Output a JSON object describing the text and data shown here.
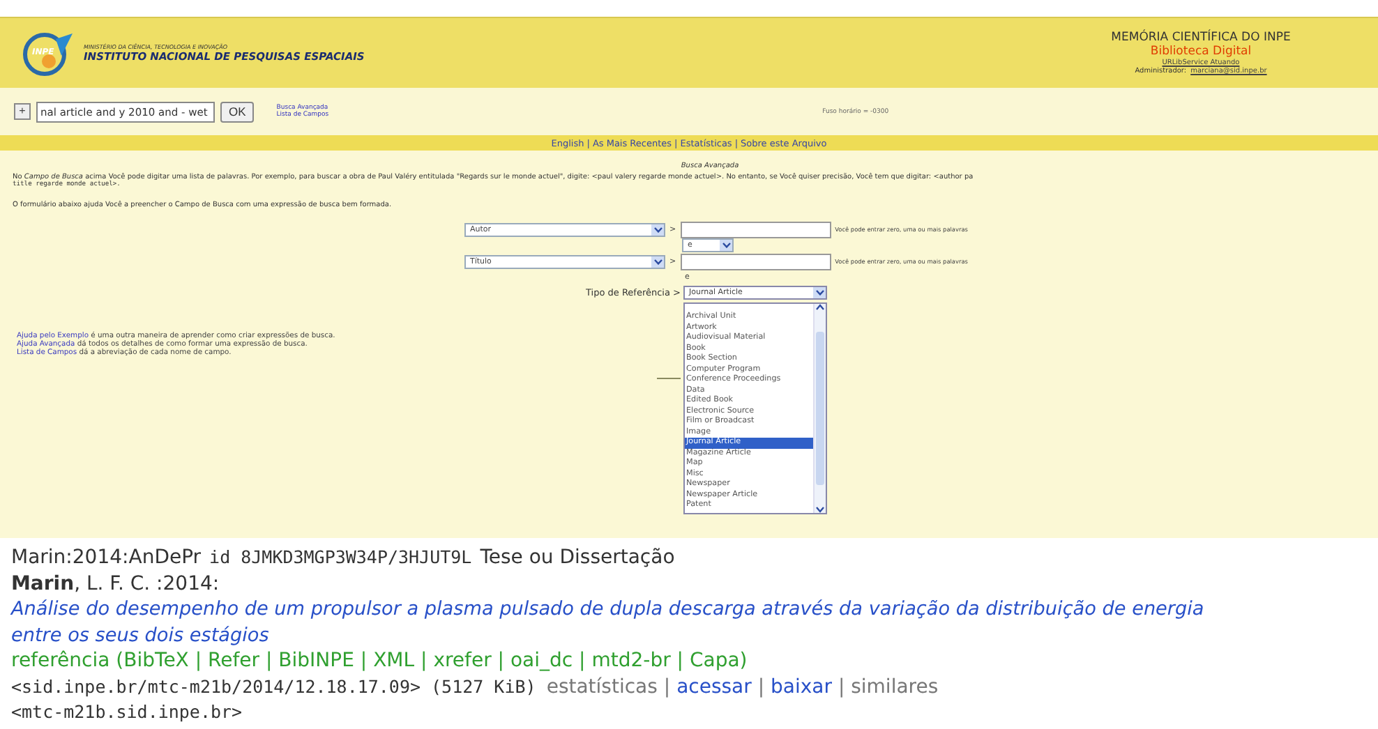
{
  "header": {
    "logo_text": "INPE",
    "ministry": "MINISTÉRIO DA CIÊNCIA, TECNOLOGIA E INOVAÇÃO",
    "institute": "INSTITUTO NACIONAL DE PESQUISAS ESPACIAIS",
    "site_title": "MEMÓRIA CIENTÍFICA DO INPE",
    "site_subtitle": "Biblioteca Digital",
    "service_link": "URLibService Atuando",
    "admin_label": "Administrador:",
    "admin_email": "marciana@sid.inpe.br"
  },
  "toolbar": {
    "expand_button": "+",
    "search_value": "nal article and y 2010 and - wet",
    "ok_button": "OK",
    "links": [
      "Busca Avançada",
      "Lista de Campos"
    ],
    "timezone": "Fuso horário = -0300"
  },
  "nav": {
    "links": [
      "English",
      "As Mais Recentes",
      "Estatísticas",
      "Sobre este Arquivo"
    ],
    "separator": "|"
  },
  "content": {
    "title": "Busca Avançada",
    "intro_line": "No *Campo de Busca* acima Você pode digitar uma lista de palavras. Por exemplo, para buscar a obra de Paul Valéry entitulada \"Regards sur le monde actuel\", digite: <paul valery regarde monde actuel>. No entanto, se Você quiser precisão, Você tem que digitar: <author pa",
    "intro_code": "title regarde monde actuel>.",
    "form_help": "O formulário abaixo ajuda Você a preencher o Campo de Busca com uma expressão de busca bem formada.",
    "rows": [
      {
        "field": "Autor",
        "hint": "Você pode entrar zero, uma ou mais palavras"
      },
      {
        "field": "Título",
        "hint": "Você pode entrar zero, uma ou mais palavras"
      }
    ],
    "connector": "e",
    "connector_2": "e",
    "arrow": ">",
    "reference_label": "Tipo de Referência >",
    "reference_value": "Journal Article",
    "reference_options": [
      {
        "label": "Archival Unit",
        "selected": false
      },
      {
        "label": "Artwork",
        "selected": false
      },
      {
        "label": "Audiovisual Material",
        "selected": false
      },
      {
        "label": "Book",
        "selected": false
      },
      {
        "label": "Book Section",
        "selected": false
      },
      {
        "label": "Computer Program",
        "selected": false
      },
      {
        "label": "Conference Proceedings",
        "selected": false
      },
      {
        "label": "Data",
        "selected": false
      },
      {
        "label": "Edited Book",
        "selected": false
      },
      {
        "label": "Electronic Source",
        "selected": false
      },
      {
        "label": "Film or Broadcast",
        "selected": false
      },
      {
        "label": "Image",
        "selected": false
      },
      {
        "label": "Journal Article",
        "selected": true
      },
      {
        "label": "Magazine Article",
        "selected": false
      },
      {
        "label": "Map",
        "selected": false
      },
      {
        "label": "Misc",
        "selected": false
      },
      {
        "label": "Newspaper",
        "selected": false
      },
      {
        "label": "Newspaper Article",
        "selected": false
      },
      {
        "label": "Patent",
        "selected": false
      }
    ],
    "help": [
      {
        "link": "Ajuda pelo Exemplo",
        "text": "é uma outra maneira de aprender como criar expressões de busca."
      },
      {
        "link": "Ajuda Avançada",
        "text": "dá todos os detalhes de como formar uma expressão de busca."
      },
      {
        "link": "Lista de Campos",
        "text": "dá a abreviação de cada nome de campo."
      }
    ]
  },
  "record": {
    "key": "Marin:2014:AnDePr",
    "id": "id 8JMKD3MGP3W34P/3HJUT9L",
    "type": "Tese ou Dissertação",
    "author": "**Marin**, L. F. C. :2014:",
    "title_line_1": "Análise do desempenho de um propulsor a plasma pulsado de dupla descarga através da variação da distribuição de energia",
    "title_line_2": "entre os seus dois estágios",
    "ref_label": "referência",
    "open_paren": "(",
    "close_paren": ")",
    "separator": "|",
    "formats": [
      "BibTeX",
      "Refer",
      "BibINPE",
      "XML",
      "xrefer",
      "oai_dc",
      "mtd2-br",
      "Capa"
    ],
    "repository": "<sid.inpe.br/mtc-m21b/2014/12.18.17.09>",
    "size": "(5127 KiB)",
    "actions": [
      {
        "label": "estatísticas",
        "kind": "text"
      },
      {
        "label": "acessar",
        "kind": "link"
      },
      {
        "label": "baixar",
        "kind": "link"
      },
      {
        "label": "similares",
        "kind": "text"
      }
    ],
    "mirror": "<mtc-m21b.sid.inpe.br>"
  }
}
